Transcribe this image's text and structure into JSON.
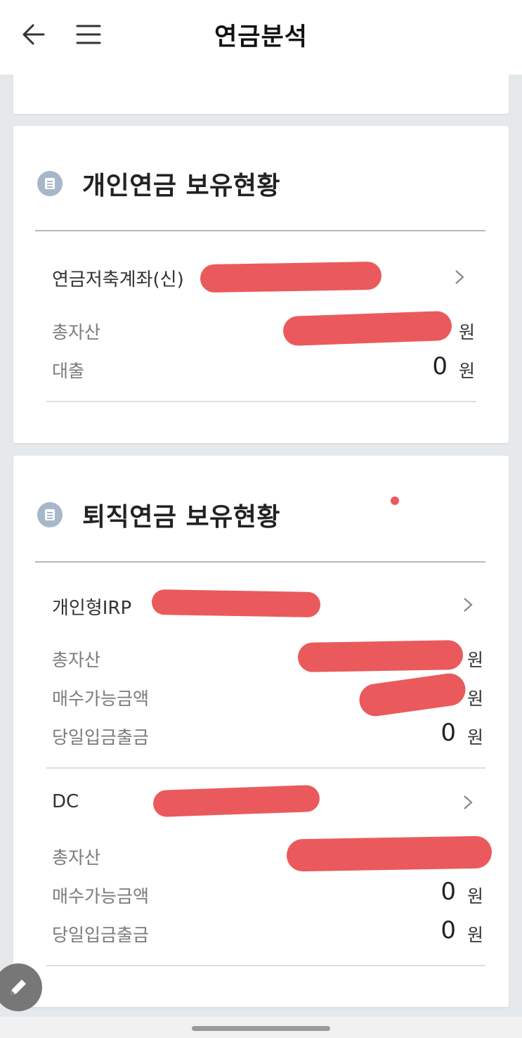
{
  "header": {
    "title": "연금분석"
  },
  "personal": {
    "title": "개인연금 보유현황",
    "accounts": [
      {
        "name": "연금저축계좌(신)",
        "rows": [
          {
            "label": "총자산",
            "value": "",
            "unit": "원"
          },
          {
            "label": "대출",
            "value": "0",
            "unit": "원"
          }
        ]
      }
    ]
  },
  "retirement": {
    "title": "퇴직연금 보유현황",
    "accounts": [
      {
        "name": "개인형IRP",
        "rows": [
          {
            "label": "총자산",
            "value": "",
            "unit": "원"
          },
          {
            "label": "매수가능금액",
            "value": "",
            "unit": "원"
          },
          {
            "label": "당일입금출금",
            "value": "0",
            "unit": "원"
          }
        ]
      },
      {
        "name": "DC",
        "rows": [
          {
            "label": "총자산",
            "value": "",
            "unit": ""
          },
          {
            "label": "매수가능금액",
            "value": "0",
            "unit": "원"
          },
          {
            "label": "당일입금출금",
            "value": "0",
            "unit": "원"
          }
        ]
      }
    ]
  },
  "colors": {
    "redaction": "#ea5a5c",
    "icon_bg": "#a7b7c9",
    "background": "#e6e9ec"
  },
  "icons": [
    "arrow-left-icon",
    "hamburger-menu-icon",
    "document-list-icon",
    "chevron-right-icon",
    "pencil-icon"
  ]
}
